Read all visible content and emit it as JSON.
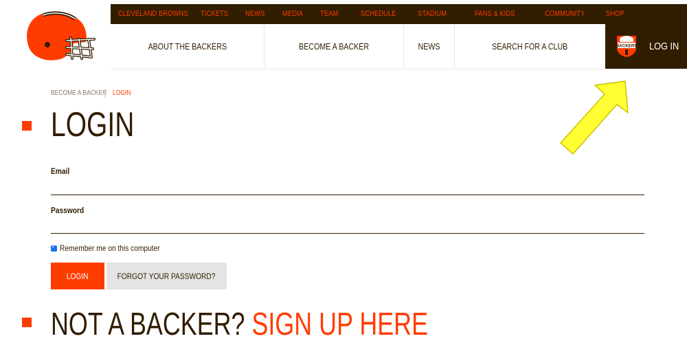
{
  "top_nav": [
    "CLEVELAND BROWNS",
    "TICKETS",
    "NEWS",
    "MEDIA",
    "TEAM",
    "SCHEDULE",
    "STADIUM",
    "FANS & KIDS",
    "COMMUNITY",
    "SHOP"
  ],
  "main_nav": [
    "ABOUT THE BACKERS",
    "BECOME A BACKER",
    "NEWS",
    "SEARCH FOR A CLUB"
  ],
  "login_link": "LOG IN",
  "badge_text": "BACKERS",
  "breadcrumb": {
    "parent": "BECOME A BACKER",
    "current": "LOGIN"
  },
  "page_title": "LOGIN",
  "form": {
    "email_label": "Email",
    "password_label": "Password",
    "remember_label": "Remember me on this computer",
    "remember_checked": true,
    "login_button": "LOGIN",
    "forgot_button": "FORGOT YOUR PASSWORD?"
  },
  "promo": {
    "text": "NOT A BACKER?",
    "link": "SIGN UP HERE"
  },
  "colors": {
    "brown": "#311d00",
    "orange": "#ff3c00",
    "annotation_arrow": "#ffff33"
  },
  "icons": [
    "browns-helmet-logo",
    "backers-badge-icon",
    "checkbox-icon",
    "annotation-arrow"
  ]
}
